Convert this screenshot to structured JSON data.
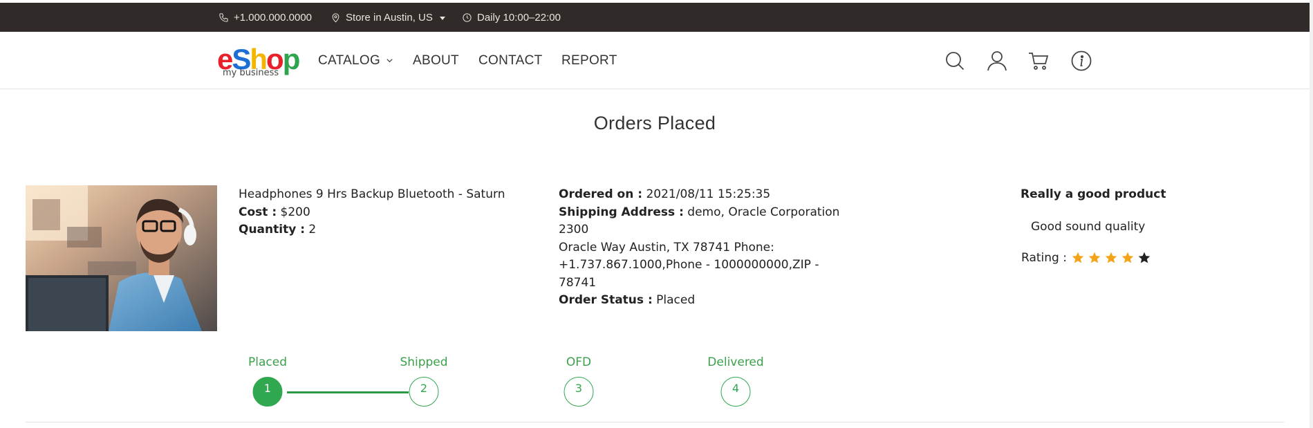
{
  "topbar": {
    "phone": "+1.000.000.0000",
    "store": "Store in Austin, US",
    "hours": "Daily 10:00–22:00"
  },
  "logo": {
    "letters": [
      "e",
      "S",
      "h",
      "o",
      "p"
    ],
    "colors": [
      "#e8202a",
      "#1c6fd4",
      "#f4b400",
      "#e8202a",
      "#2ea44f"
    ],
    "subtitle": "my business"
  },
  "nav": {
    "catalog": "CATALOG",
    "about": "ABOUT",
    "contact": "CONTACT",
    "report": "REPORT"
  },
  "header_icons": [
    "search-icon",
    "user-icon",
    "cart-icon",
    "info-icon"
  ],
  "page": {
    "title": "Orders Placed"
  },
  "order": {
    "product_name": "Headphones 9 Hrs Backup Bluetooth - Saturn",
    "cost_label": "Cost :",
    "cost_value": "$200",
    "quantity_label": "Quantity :",
    "quantity_value": "2",
    "ordered_on_label": "Ordered on :",
    "ordered_on_value": "2021/08/11 15:25:35",
    "shipping_label": "Shipping Address :",
    "shipping_line1": "demo, Oracle Corporation 2300",
    "shipping_line2": "Oracle Way Austin, TX 78741 Phone:",
    "shipping_line3": "+1.737.867.1000,Phone - 1000000000,ZIP - 78741",
    "status_label": "Order Status :",
    "status_value": "Placed"
  },
  "review": {
    "title": "Really a good product",
    "text": "Good sound quality",
    "rating_label": "Rating :",
    "rating": 4,
    "max_rating": 5,
    "star_filled_color": "#f5a31a",
    "star_empty_color": "#222222"
  },
  "progress": {
    "steps": [
      {
        "label": "Placed",
        "number": "1"
      },
      {
        "label": "Shipped",
        "number": "2"
      },
      {
        "label": "OFD",
        "number": "3"
      },
      {
        "label": "Delivered",
        "number": "4"
      }
    ],
    "completed": 1,
    "accent": "#2fa84f"
  }
}
